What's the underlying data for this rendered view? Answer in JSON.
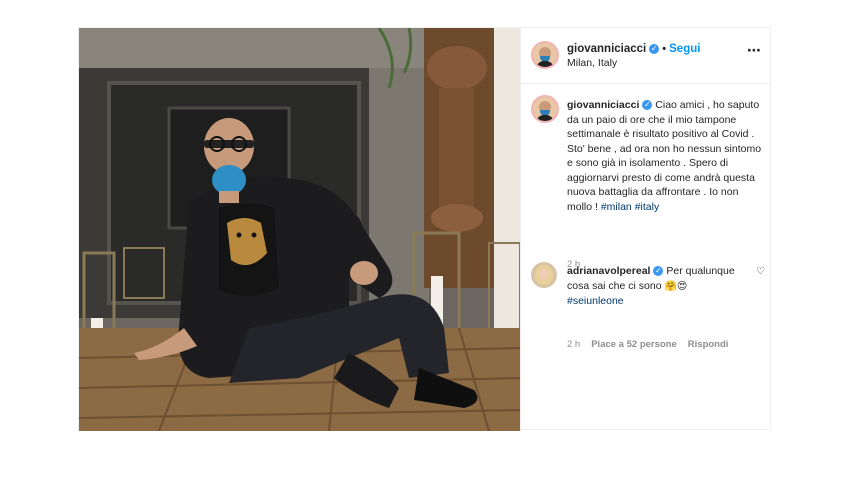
{
  "post": {
    "author": {
      "username": "giovanniciacci",
      "follow_label": "Segui",
      "location": "Milan, Italy",
      "dot": "•",
      "more_icon": "⋯"
    },
    "caption": {
      "username": "giovanniciacci",
      "text": "Ciao amici , ho saputo da un paio di ore che il mio tampone settimanale è risultato positivo al Covid . Sto' bene , ad ora non ho nessun sintomo e sono già in isolamento . Spero di aggiornarvi presto di come andrà questa nuova battaglia da affrontare . Io non mollo ! ",
      "hashtags": [
        "#milan",
        "#italy"
      ],
      "time": "2 h"
    },
    "comments": [
      {
        "username": "adrianavolpereal",
        "text": "Per qualunque cosa sai che ci sono ",
        "emojis": "🤗😍",
        "hashtag": "#seiunleone",
        "time": "2 h",
        "likes": "Piace a 52 persone",
        "reply_label": "Rispondi",
        "heart_icon": "♡"
      }
    ]
  },
  "colors": {
    "link_blue": "#0095f6",
    "hashtag_blue": "#00376b",
    "verified_blue": "#3897f0",
    "muted": "#8e8e8e"
  }
}
